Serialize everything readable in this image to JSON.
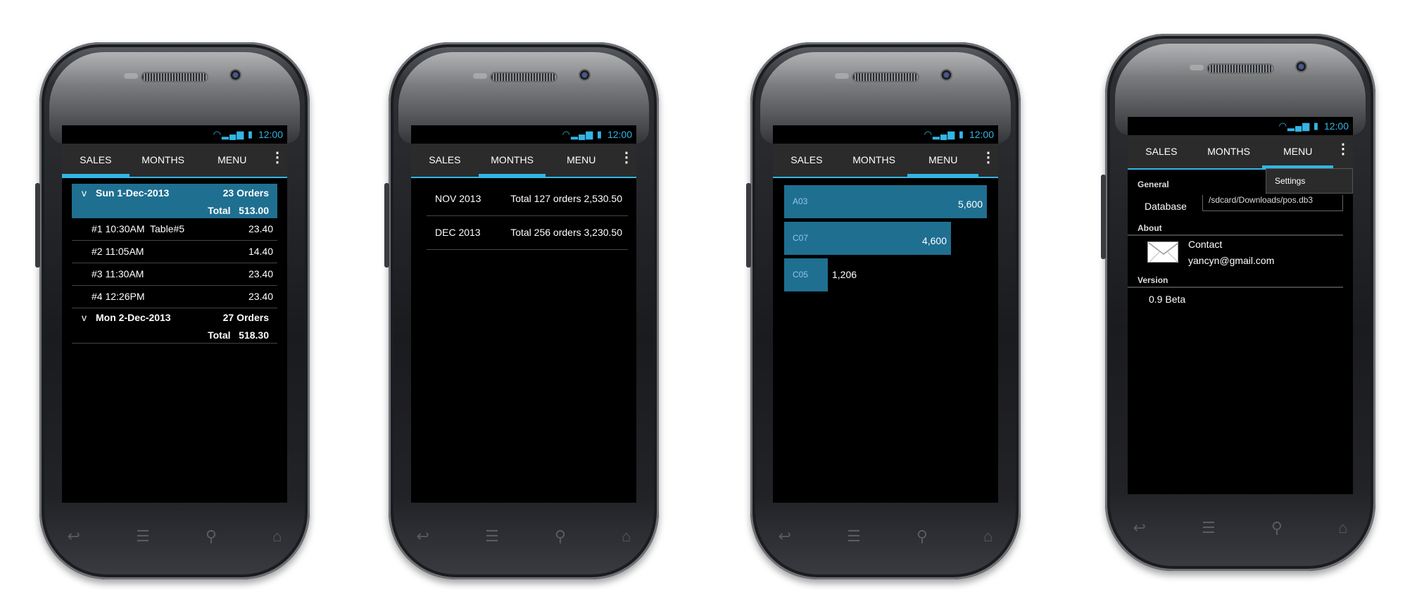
{
  "status_time": "12:00",
  "tabs": {
    "sales": "SALES",
    "months": "MONTHS",
    "menu": "MENU"
  },
  "screen1": {
    "days": [
      {
        "chevron": "v",
        "date": "Sun 1-Dec-2013",
        "orders": "23 Orders",
        "total_label": "Total",
        "total": "513.00",
        "items": [
          {
            "label": "#1 10:30AM  Table#5",
            "amount": "23.40"
          },
          {
            "label": "#2 11:05AM",
            "amount": "14.40"
          },
          {
            "label": "#3 11:30AM",
            "amount": "23.40"
          },
          {
            "label": "#4 12:26PM",
            "amount": "23.40"
          }
        ]
      },
      {
        "chevron": "v",
        "date": "Mon 2-Dec-2013",
        "orders": "27 Orders",
        "total_label": "Total",
        "total": "518.30"
      }
    ]
  },
  "screen2": {
    "months": [
      {
        "month": "NOV 2013",
        "summary": "Total 127 orders 2,530.50"
      },
      {
        "month": "DEC 2013",
        "summary": "Total 256 orders 3,230.50"
      }
    ]
  },
  "screen3": {
    "bars": [
      {
        "label": "A03",
        "value": 5600,
        "value_text": "5,600"
      },
      {
        "label": "C07",
        "value": 4600,
        "value_text": "4,600"
      },
      {
        "label": "C05",
        "value": 1206,
        "value_text": "1,206"
      }
    ]
  },
  "screen4": {
    "general_header": "General",
    "database_label": "Database",
    "database_path": "/sdcard/Downloads/pos.db3",
    "about_header": "About",
    "contact_label": "Contact",
    "contact_email": "yancyn@gmail.com",
    "version_header": "Version",
    "version_value": "0.9 Beta",
    "popup_item": "Settings"
  },
  "icons": {
    "status": "wifi-signal-battery-icons",
    "overflow": "overflow-menu-icon",
    "nav": [
      "back-icon",
      "recent-icon",
      "search-icon",
      "home-icon"
    ],
    "mail": "mail-icon"
  },
  "colors": {
    "accent": "#33b5e5",
    "highlight": "#1f6f91",
    "background": "#000000"
  }
}
